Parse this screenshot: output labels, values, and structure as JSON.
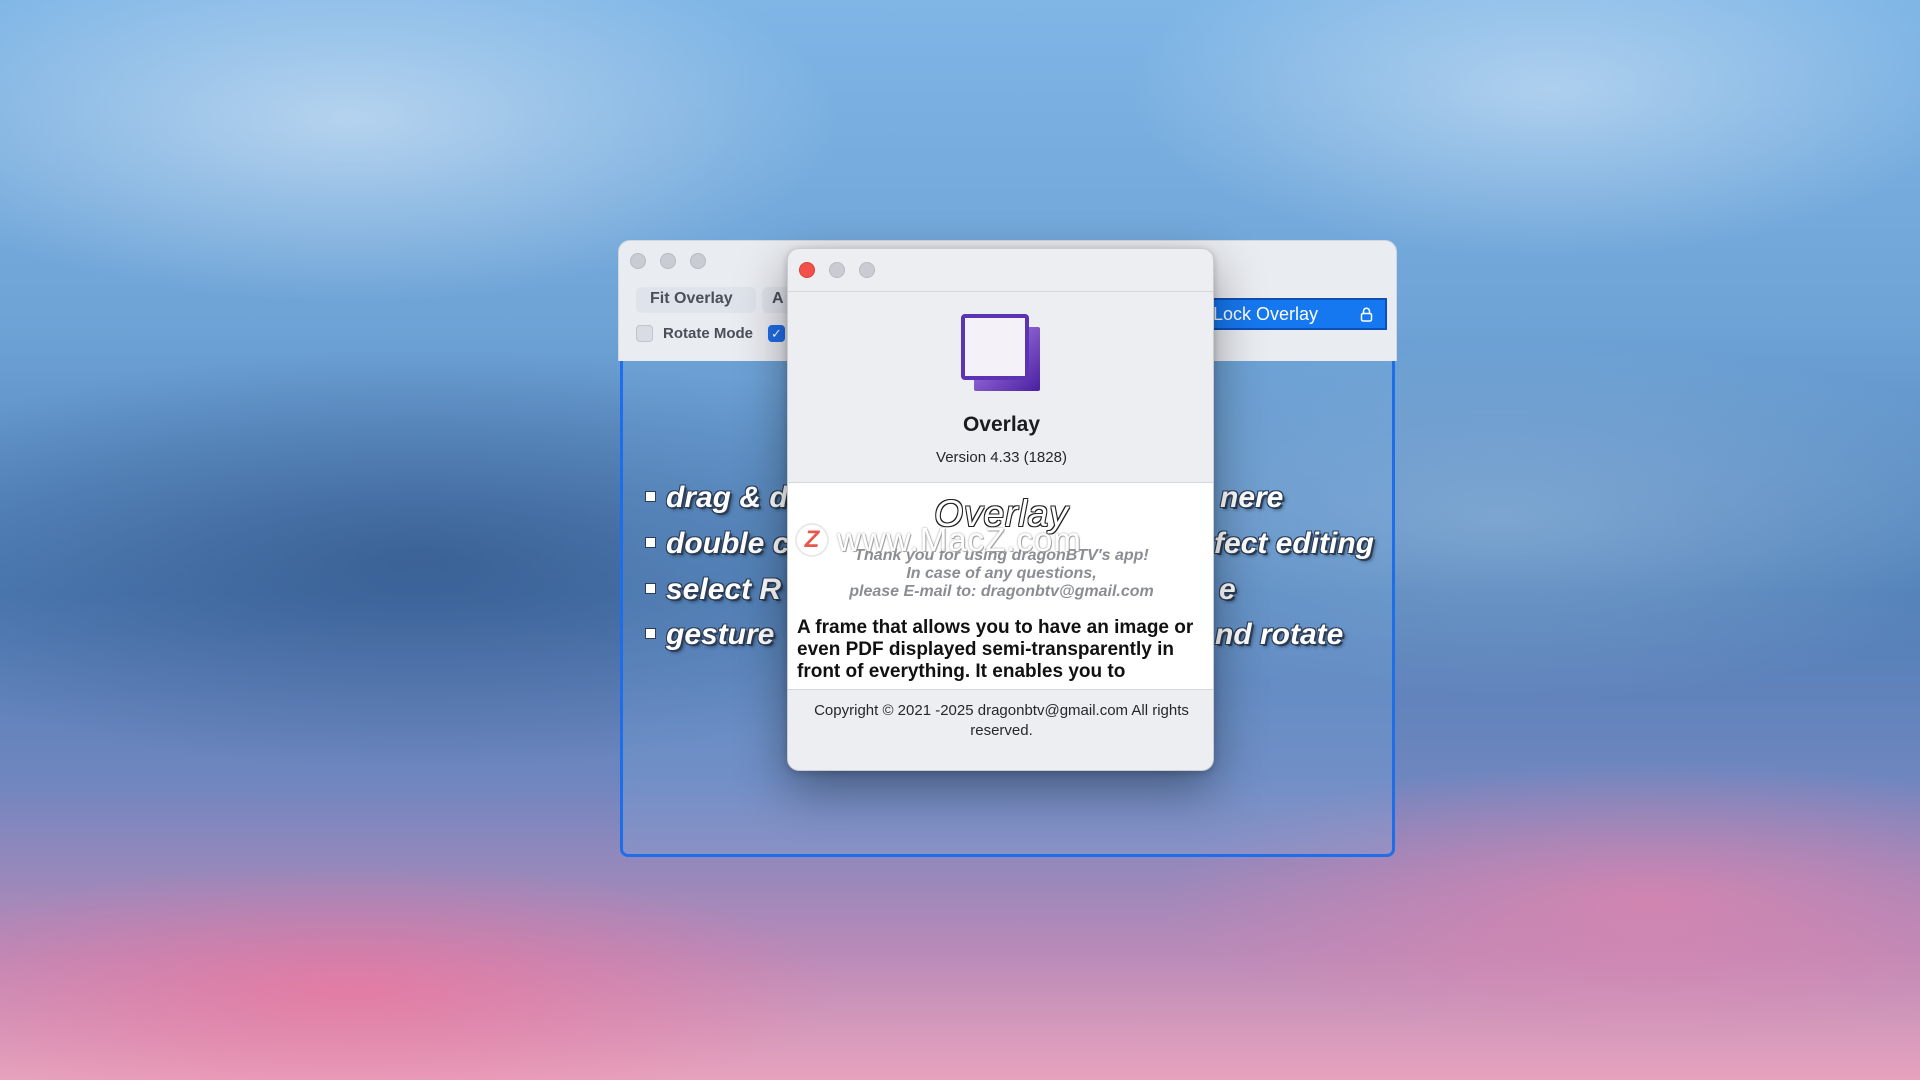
{
  "main_window": {
    "fit_overlay_label": "Fit Overlay",
    "second_button_label": "A",
    "rotate_mode_label": "Rotate Mode",
    "lock_overlay_label": "Lock Overlay",
    "lock_icon": "lock-icon",
    "bullets": [
      "drag & d",
      "double c",
      "select R",
      "gesture"
    ],
    "bullets_right": [
      "nere",
      "fect editing",
      "e",
      "nd rotate"
    ]
  },
  "about": {
    "app_icon": "overlay-app-icon",
    "app_name": "Overlay",
    "version": "Version 4.33 (1828)",
    "credits_title": "Overlay",
    "credits_lines": [
      "Thank you for using dragonBTV's app!",
      "In case of any questions,",
      "please E-mail to: dragonbtv@gmail.com"
    ],
    "description": "A frame that allows you to have an image or even PDF displayed semi-transparently in front of everything. It enables you to",
    "copyright": "Copyright © 2021 -2025 dragonbtv@gmail.com  All rights reserved."
  },
  "watermark": {
    "logo_letter": "Z",
    "text": "www.MacZ.com"
  },
  "colors": {
    "accent_blue": "#1f6ee8",
    "close_red": "#f2514a"
  }
}
